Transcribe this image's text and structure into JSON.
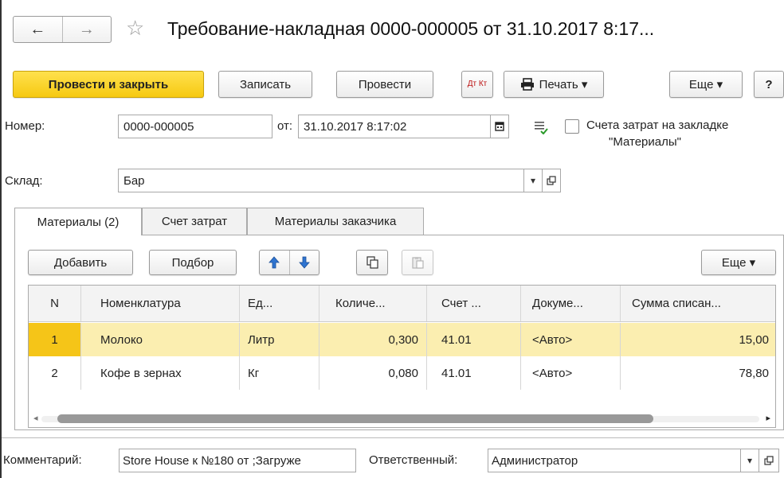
{
  "header": {
    "title": "Требование-накладная 0000-000005 от 31.10.2017 8:17...",
    "back_icon": "←",
    "forward_icon": "→",
    "star_icon": "☆"
  },
  "toolbar": {
    "post_close": "Провести и закрыть",
    "save": "Записать",
    "post": "Провести",
    "dtkt": "Дт Кт",
    "print": "Печать ▾",
    "more": "Еще ▾",
    "help": "?"
  },
  "form": {
    "number_label": "Номер:",
    "number_value": "0000-000005",
    "date_label": "от:",
    "date_value": "31.10.2017  8:17:02",
    "checkbox_label_line1": "Счета затрат на закладке",
    "checkbox_label_line2": "\"Материалы\"",
    "warehouse_label": "Склад:",
    "warehouse_value": "Бар"
  },
  "tabs": [
    {
      "label": "Материалы (2)"
    },
    {
      "label": "Счет затрат"
    },
    {
      "label": "Материалы заказчика"
    }
  ],
  "tabbar": {
    "add": "Добавить",
    "pick": "Подбор",
    "more": "Еще ▾"
  },
  "table": {
    "columns": [
      "N",
      "Номенклатура",
      "Ед...",
      "Количе...",
      "Счет ...",
      "Докуме...",
      "Сумма списан..."
    ],
    "rows": [
      [
        "1",
        "Молоко",
        "Литр",
        "0,300",
        "41.01",
        "<Авто>",
        "15,00"
      ],
      [
        "2",
        "Кофе в зернах",
        "Кг",
        "0,080",
        "41.01",
        "<Авто>",
        "78,80"
      ]
    ]
  },
  "footer": {
    "comment_label": "Комментарий:",
    "comment_value": "Store House к №180 от ;Загруже",
    "responsible_label": "Ответственный:",
    "responsible_value": "Администратор"
  },
  "colors": {
    "primary_button": "#f6c912",
    "selected_row": "#fbeeb0",
    "selected_num": "#f5c518"
  }
}
